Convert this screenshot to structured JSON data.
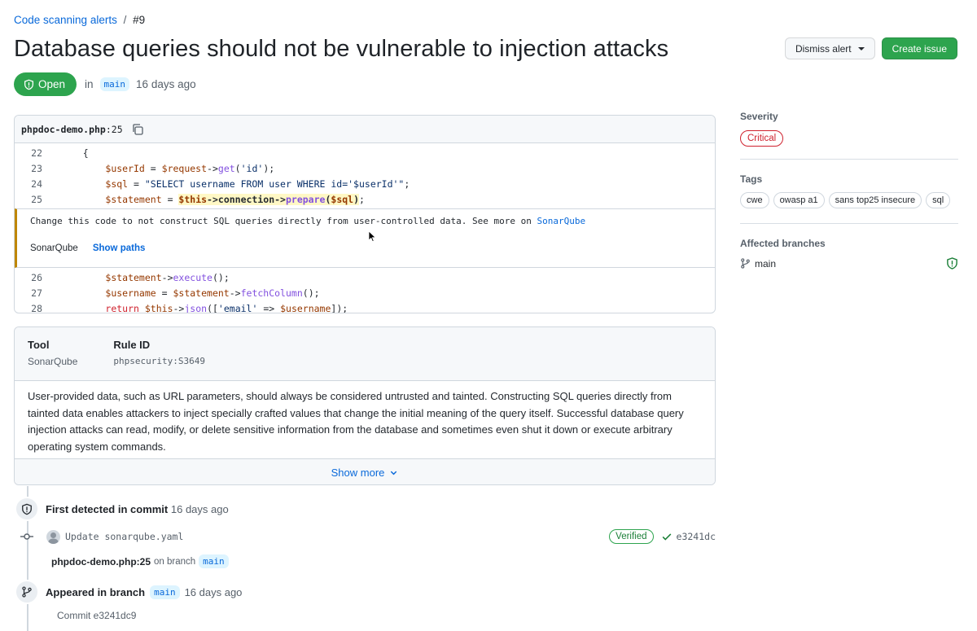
{
  "breadcrumb": {
    "parent": "Code scanning alerts",
    "separator": "/",
    "current": "#9"
  },
  "title": "Database queries should not be vulnerable to injection attacks",
  "actions": {
    "dismiss_label": "Dismiss alert",
    "create_label": "Create issue"
  },
  "status": {
    "label": "Open",
    "in_text": "in",
    "branch": "main",
    "age": "16 days ago"
  },
  "code_panel": {
    "file_name": "phpdoc-demo.php",
    "line_suffix": ":25",
    "lines_before": [
      {
        "num": "22",
        "text": "{"
      },
      {
        "num": "23",
        "text": "$userId = $request->get('id');"
      },
      {
        "num": "24",
        "text": "$sql = \"SELECT username FROM user WHERE id='$userId'\";"
      },
      {
        "num": "25",
        "text": "$statement = $this->connection->prepare($sql);"
      }
    ],
    "annotation_message": "Change this code to not construct SQL queries directly from user-controlled data. See more on",
    "annotation_link": "SonarQube",
    "annotation_tool": "SonarQube",
    "show_paths_label": "Show paths",
    "lines_after": [
      {
        "num": "26",
        "text": "$statement->execute();"
      },
      {
        "num": "27",
        "text": "$username = $statement->fetchColumn();"
      },
      {
        "num": "28",
        "text": "return $this->json(['email' => $username]);"
      }
    ]
  },
  "rule": {
    "tool_label": "Tool",
    "tool_value": "SonarQube",
    "rule_label": "Rule ID",
    "rule_value": "phpsecurity:S3649",
    "description": "User-provided data, such as URL parameters, should always be considered untrusted and tainted. Constructing SQL queries directly from tainted data enables attackers to inject specially crafted values that change the initial meaning of the query itself. Successful database query injection attacks can read, modify, or delete sensitive information from the database and sometimes even shut it down or execute arbitrary operating system commands.",
    "show_more_label": "Show more"
  },
  "timeline": {
    "first_detected": {
      "title": "First detected in commit",
      "age": "16 days ago"
    },
    "commit": {
      "message": "Update sonarqube.yaml",
      "verified": "Verified",
      "sha": "e3241dc"
    },
    "location": {
      "file": "phpdoc-demo.php:25",
      "on_branch": "on branch",
      "branch": "main"
    },
    "appeared": {
      "title": "Appeared in branch",
      "branch": "main",
      "age": "16 days ago"
    },
    "commit_ref": "Commit e3241dc9"
  },
  "sidebar": {
    "severity_label": "Severity",
    "severity_value": "Critical",
    "tags_label": "Tags",
    "tags": [
      "cwe",
      "owasp a1",
      "sans top25 insecure",
      "sql"
    ],
    "branches_label": "Affected branches",
    "branch": "main"
  },
  "colors": {
    "accent": "#0969da",
    "success": "#2da44e",
    "danger": "#cf222e",
    "warning": "#bf8700"
  }
}
